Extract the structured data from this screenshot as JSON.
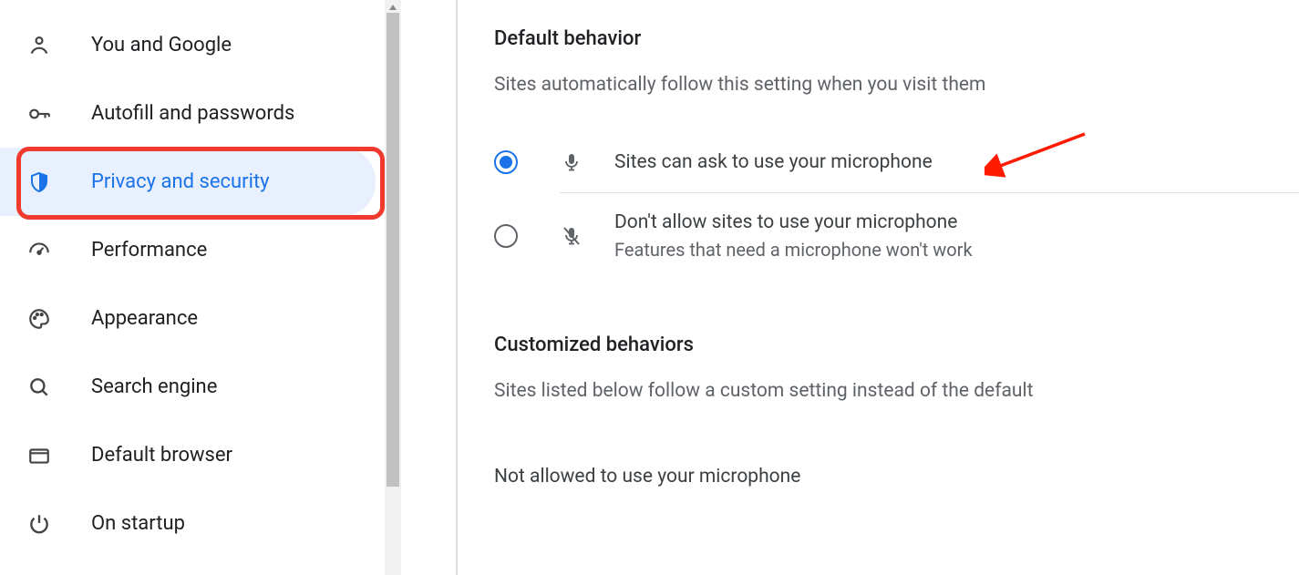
{
  "sidebar": {
    "items": [
      {
        "label": "You and Google"
      },
      {
        "label": "Autofill and passwords"
      },
      {
        "label": "Privacy and security"
      },
      {
        "label": "Performance"
      },
      {
        "label": "Appearance"
      },
      {
        "label": "Search engine"
      },
      {
        "label": "Default browser"
      },
      {
        "label": "On startup"
      }
    ],
    "selected_index": 2
  },
  "main": {
    "section1_title": "Default behavior",
    "section1_desc": "Sites automatically follow this setting when you visit them",
    "option1_label": "Sites can ask to use your microphone",
    "option2_label": "Don't allow sites to use your microphone",
    "option2_sub": "Features that need a microphone won't work",
    "section2_title": "Customized behaviors",
    "section2_desc": "Sites listed below follow a custom setting instead of the default",
    "section3_title": "Not allowed to use your microphone"
  }
}
